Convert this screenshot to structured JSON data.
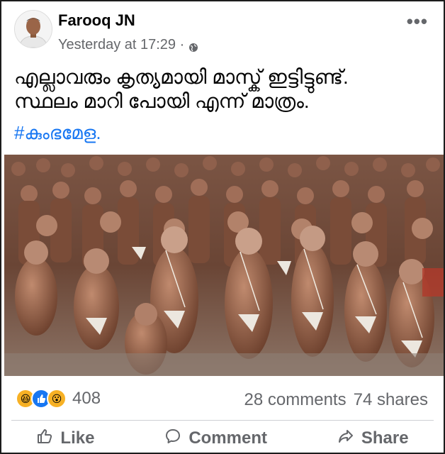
{
  "post": {
    "author": "Farooq JN",
    "timestamp": "Yesterday at 17:29 ·",
    "privacy_icon": "globe-icon",
    "menu_icon": "more-options-icon",
    "text_line1": "എല്ലാവരും കൃത്യമായി മാസ്ക് ഇട്ടിട്ടുണ്ട്.",
    "text_line2": "സ്ഥലം മാറി പോയി എന്ന് മാത്രം.",
    "hashtag": "#കുംഭമേള."
  },
  "engagement": {
    "reaction_icons": [
      "haha-reaction-icon",
      "like-reaction-icon",
      "wow-reaction-icon"
    ],
    "reaction_count": "408",
    "comments": "28 comments",
    "shares": "74 shares"
  },
  "actions": {
    "like": "Like",
    "comment": "Comment",
    "share": "Share"
  },
  "colors": {
    "link_blue": "#1877f2",
    "secondary_text": "#65676b",
    "reaction_yellow": "#f7b125"
  }
}
